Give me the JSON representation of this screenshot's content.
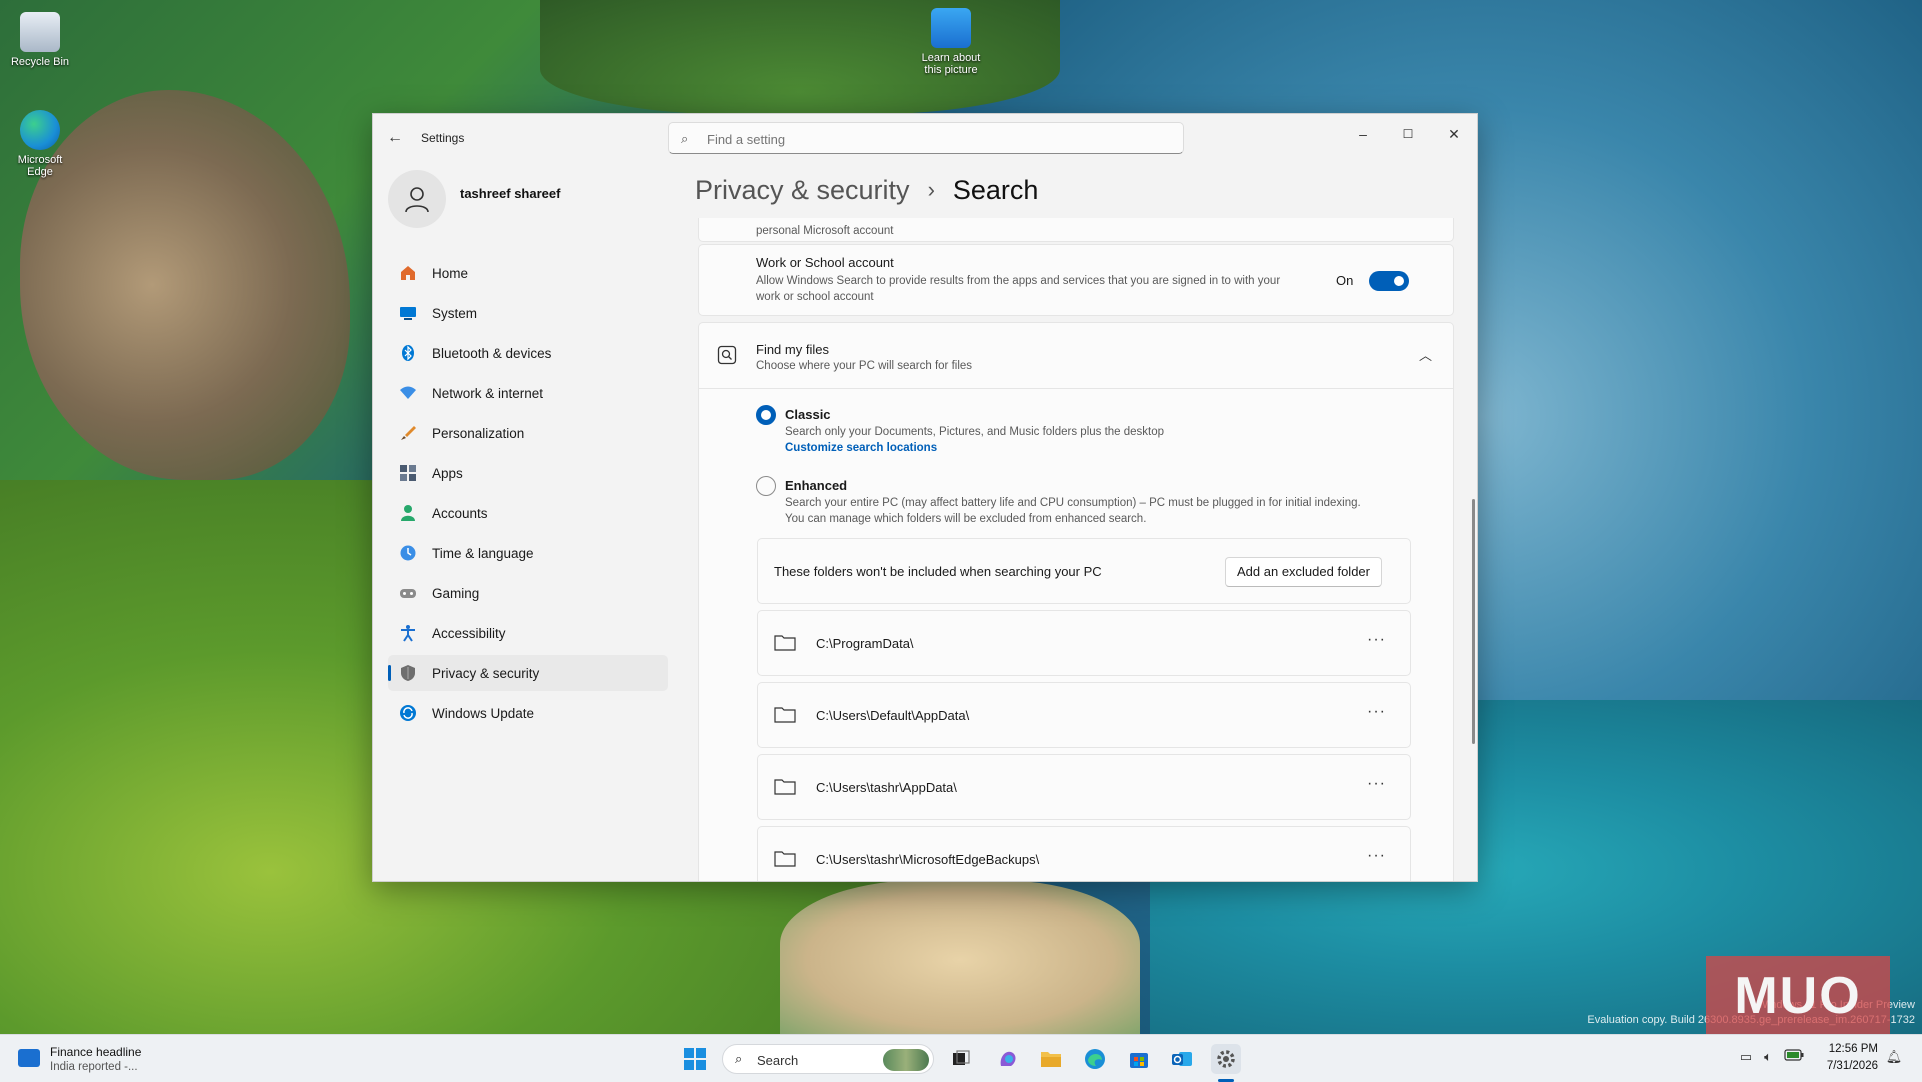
{
  "desktop": {
    "icons": [
      {
        "label": "Recycle Bin"
      },
      {
        "label": "Microsoft Edge"
      },
      {
        "label": "Learn about this picture"
      }
    ],
    "build_line1": "Windows 11 Pro Insider Preview",
    "build_line2": "Evaluation copy. Build 26300.8935.ge_prerelease_im.260717-1732",
    "watermark": "MUO"
  },
  "window": {
    "title": "Settings",
    "search_placeholder": "Find a setting",
    "controls": {
      "minimize": "–",
      "maximize": "☐",
      "close": "✕"
    }
  },
  "profile": {
    "name": "tashreef shareef"
  },
  "sidebar": {
    "items": [
      {
        "label": "Home",
        "icon": "home-icon",
        "color": "#e06a2c"
      },
      {
        "label": "System",
        "icon": "system-icon",
        "color": "#0078d4"
      },
      {
        "label": "Bluetooth & devices",
        "icon": "bluetooth-icon",
        "color": "#0078d4"
      },
      {
        "label": "Network & internet",
        "icon": "wifi-icon",
        "color": "#3a8ee6"
      },
      {
        "label": "Personalization",
        "icon": "brush-icon",
        "color": "#e08a2c"
      },
      {
        "label": "Apps",
        "icon": "apps-icon",
        "color": "#4a5a70"
      },
      {
        "label": "Accounts",
        "icon": "accounts-icon",
        "color": "#27a86b"
      },
      {
        "label": "Time & language",
        "icon": "clock-globe-icon",
        "color": "#3a8ee6"
      },
      {
        "label": "Gaming",
        "icon": "gamepad-icon",
        "color": "#7a7a7a"
      },
      {
        "label": "Accessibility",
        "icon": "accessibility-icon",
        "color": "#1a6fd0"
      },
      {
        "label": "Privacy & security",
        "icon": "shield-icon",
        "color": "#6e6e6e",
        "active": true
      },
      {
        "label": "Windows Update",
        "icon": "update-icon",
        "color": "#0078d4"
      }
    ]
  },
  "breadcrumb": {
    "parent": "Privacy & security",
    "separator": "›",
    "current": "Search"
  },
  "content": {
    "partial_row_text": "personal Microsoft account",
    "work_account": {
      "title": "Work or School account",
      "description_line1": "Allow Windows Search to provide results from the apps and services that you are signed in to with your",
      "description_line2": "work or school account",
      "state_label": "On",
      "enabled": true
    },
    "find_my_files": {
      "title": "Find my files",
      "subtitle": "Choose where your PC will search for files",
      "expanded": true,
      "options": [
        {
          "label": "Classic",
          "description": "Search only your Documents, Pictures, and Music folders plus the desktop",
          "link": "Customize search locations",
          "selected": true
        },
        {
          "label": "Enhanced",
          "description_line1": "Search your entire PC (may affect battery life and CPU consumption) – PC must be plugged in for initial indexing.",
          "description_line2": "You can manage which folders will be excluded from enhanced search.",
          "selected": false
        }
      ],
      "excluded_header": "These folders won't be included when searching your PC",
      "add_button": "Add an excluded folder",
      "excluded_folders": [
        "C:\\ProgramData\\",
        "C:\\Users\\Default\\AppData\\",
        "C:\\Users\\tashr\\AppData\\",
        "C:\\Users\\tashr\\MicrosoftEdgeBackups\\"
      ],
      "more_glyph": "···"
    }
  },
  "taskbar": {
    "widget_title": "Finance headline",
    "widget_sub": "India reported -...",
    "search_label": "Search",
    "time": "12:56 PM",
    "date": "7/31/2026"
  },
  "colors": {
    "accent": "#005fb8"
  }
}
